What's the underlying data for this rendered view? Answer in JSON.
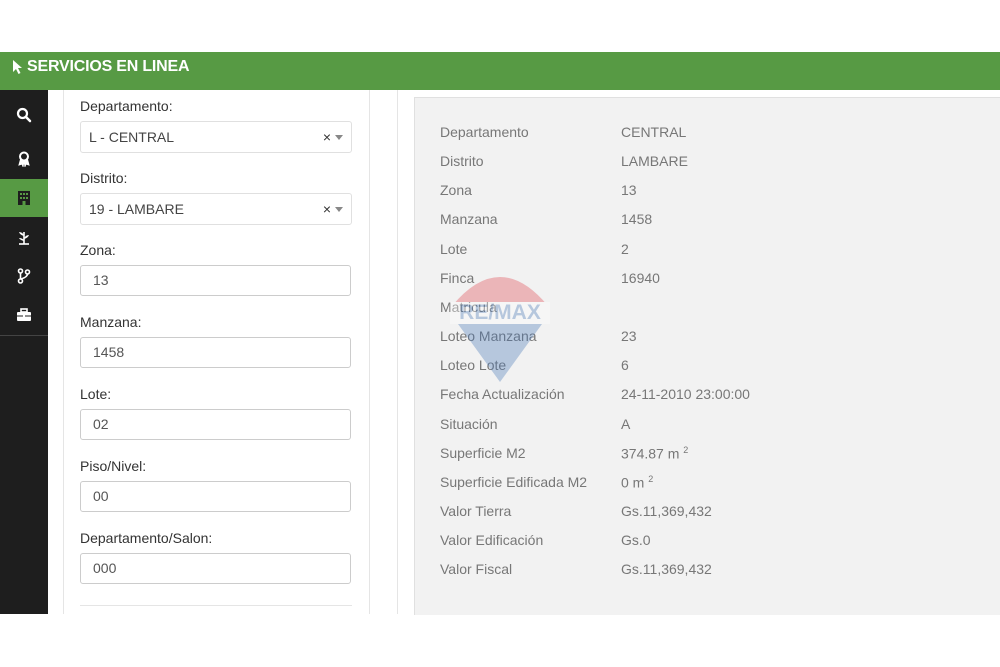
{
  "header": {
    "title": "SERVICIOS EN LINEA"
  },
  "sidebar": {
    "items": [
      {
        "icon": "search-icon"
      },
      {
        "icon": "award-icon"
      },
      {
        "icon": "building-icon",
        "active": true
      },
      {
        "icon": "plant-icon"
      },
      {
        "icon": "branch-icon"
      },
      {
        "icon": "briefcase-icon"
      }
    ]
  },
  "form": {
    "departamento": {
      "label": "Departamento:",
      "value": "L - CENTRAL",
      "clear": "×"
    },
    "distrito": {
      "label": "Distrito:",
      "value": "19 - LAMBARE",
      "clear": "×"
    },
    "zona": {
      "label": "Zona:",
      "value": "13"
    },
    "manzana": {
      "label": "Manzana:",
      "value": "1458"
    },
    "lote": {
      "label": "Lote:",
      "value": "02"
    },
    "piso": {
      "label": "Piso/Nivel:",
      "value": "00"
    },
    "salon": {
      "label": "Departamento/Salon:",
      "value": "000"
    }
  },
  "details": {
    "rows": [
      {
        "key": "Departamento",
        "value": "CENTRAL"
      },
      {
        "key": "Distrito",
        "value": "LAMBARE"
      },
      {
        "key": "Zona",
        "value": "13"
      },
      {
        "key": "Manzana",
        "value": "1458"
      },
      {
        "key": "Lote",
        "value": "2"
      },
      {
        "key": "Finca",
        "value": "16940"
      },
      {
        "key": "Matricula",
        "value": ""
      },
      {
        "key": "Loteo Manzana",
        "value": "23"
      },
      {
        "key": "Loteo Lote",
        "value": "6"
      },
      {
        "key": "Fecha Actualización",
        "value": "24-11-2010 23:00:00"
      },
      {
        "key": "Situación",
        "value": "A"
      },
      {
        "key": "Superficie M2",
        "value": "374.87 m",
        "sup": "2"
      },
      {
        "key": "Superficie Edificada M2",
        "value": "0 m",
        "sup": "2"
      },
      {
        "key": "Valor Tierra",
        "value": "Gs.11,369,432"
      },
      {
        "key": "Valor Edificación",
        "value": "Gs.0"
      },
      {
        "key": "Valor Fiscal",
        "value": "Gs.11,369,432"
      }
    ]
  },
  "watermark": {
    "text": "RE/MAX"
  },
  "colors": {
    "brand_green": "#579a44",
    "sidebar_dark": "#1e1e1e",
    "details_bg": "#f2f2f2"
  }
}
